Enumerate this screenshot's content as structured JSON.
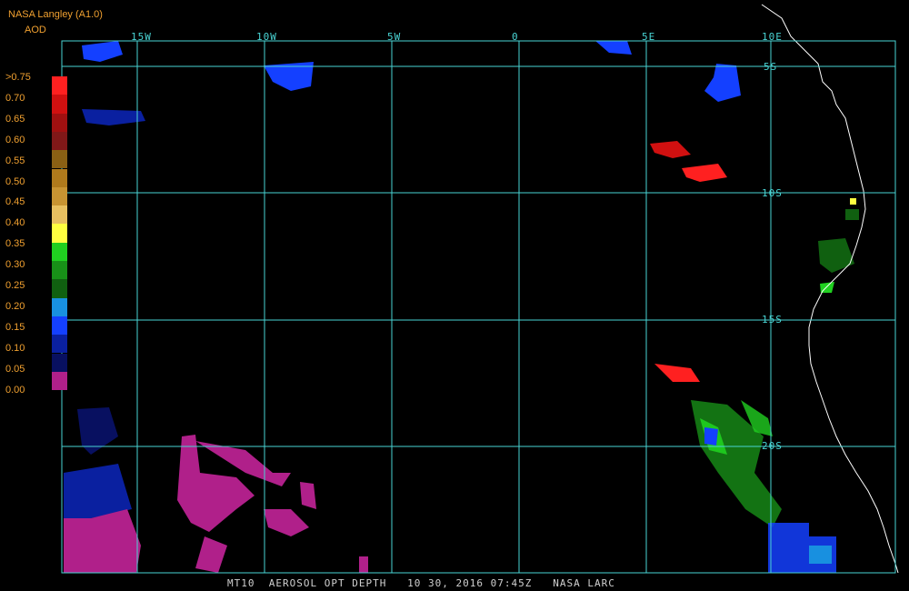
{
  "header": {
    "source": "NASA Langley (A1.0)",
    "product": "AOD"
  },
  "legend": {
    "labels": [
      ">0.75",
      "0.70",
      "0.65",
      "0.60",
      "0.55",
      "0.50",
      "0.45",
      "0.40",
      "0.35",
      "0.30",
      "0.25",
      "0.20",
      "0.15",
      "0.10",
      "0.05",
      "0.00"
    ],
    "colors": [
      "#ff2020",
      "#d01010",
      "#a01010",
      "#801818",
      "#8a6014",
      "#b07a1c",
      "#c89432",
      "#e8c060",
      "#ffff40",
      "#20d020",
      "#189018",
      "#106010",
      "#1890e0",
      "#1440ff",
      "#0a20a0",
      "#081060",
      "#b0208a"
    ]
  },
  "longitude_labels": [
    "15W",
    "10W",
    "5W",
    "0",
    "5E",
    "10E"
  ],
  "latitude_labels": [
    "5S",
    "10S",
    "15S",
    "20S"
  ],
  "footer": "MT10  AEROSOL OPT DEPTH   10 30, 2016 07:45Z   NASA LARC",
  "colors": {
    "grid": "#49d3d3",
    "coast": "#ffffff",
    "label": "#f0a030"
  }
}
